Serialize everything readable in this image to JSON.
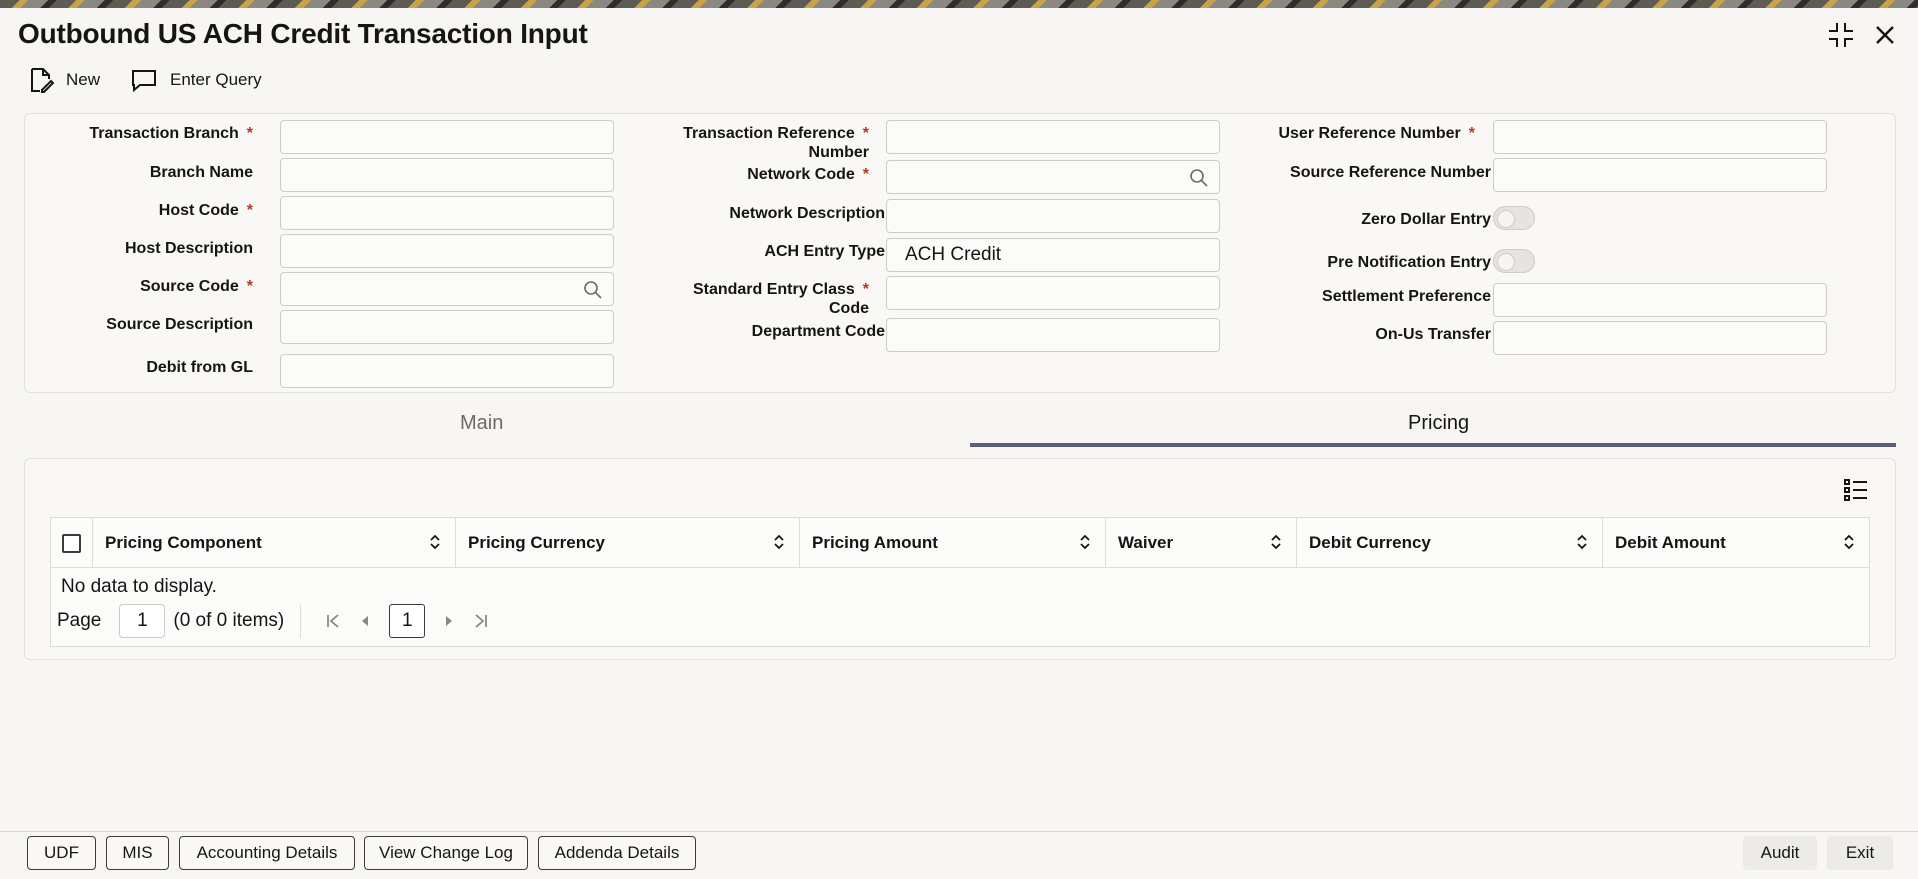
{
  "window": {
    "title": "Outbound US ACH Credit Transaction Input"
  },
  "toolbar": {
    "new_label": "New",
    "query_label": "Enter Query"
  },
  "form": {
    "transaction_branch": {
      "label": "Transaction Branch",
      "value": ""
    },
    "branch_name": {
      "label": "Branch Name",
      "value": ""
    },
    "host_code": {
      "label": "Host Code",
      "value": ""
    },
    "host_description": {
      "label": "Host Description",
      "value": ""
    },
    "source_code": {
      "label": "Source Code",
      "value": ""
    },
    "source_description": {
      "label": "Source Description",
      "value": ""
    },
    "debit_from_gl": {
      "label": "Debit from GL",
      "value": ""
    },
    "transaction_reference": {
      "label_line1": "Transaction Reference",
      "label_line2": "Number",
      "value": ""
    },
    "network_code": {
      "label": "Network Code",
      "value": ""
    },
    "network_description": {
      "label": "Network Description",
      "value": ""
    },
    "ach_entry_type": {
      "label": "ACH Entry Type",
      "value": "ACH Credit"
    },
    "standard_entry_class": {
      "label_line1": "Standard Entry Class",
      "label_line2": "Code",
      "value": ""
    },
    "department_code": {
      "label": "Department Code",
      "value": ""
    },
    "user_reference": {
      "label": "User Reference Number",
      "value": ""
    },
    "source_reference": {
      "label": "Source Reference Number",
      "value": ""
    },
    "zero_dollar_entry": {
      "label": "Zero Dollar Entry",
      "on": false
    },
    "pre_notification_entry": {
      "label": "Pre Notification Entry",
      "on": false
    },
    "settlement_preference": {
      "label": "Settlement Preference",
      "value": ""
    },
    "on_us_transfer": {
      "label": "On-Us Transfer",
      "value": ""
    },
    "required_mark": "*"
  },
  "tabs": {
    "main": "Main",
    "pricing": "Pricing"
  },
  "grid": {
    "columns": [
      "Pricing Component",
      "Pricing Currency",
      "Pricing Amount",
      "Waiver",
      "Debit Currency",
      "Debit Amount"
    ],
    "empty_text": "No data to display.",
    "pager": {
      "page_label": "Page",
      "page_value": "1",
      "summary": "(0 of 0 items)",
      "current": "1"
    }
  },
  "footer": {
    "udf": "UDF",
    "mis": "MIS",
    "accounting": "Accounting Details",
    "change_log": "View Change Log",
    "addenda": "Addenda Details",
    "audit": "Audit",
    "exit": "Exit"
  }
}
